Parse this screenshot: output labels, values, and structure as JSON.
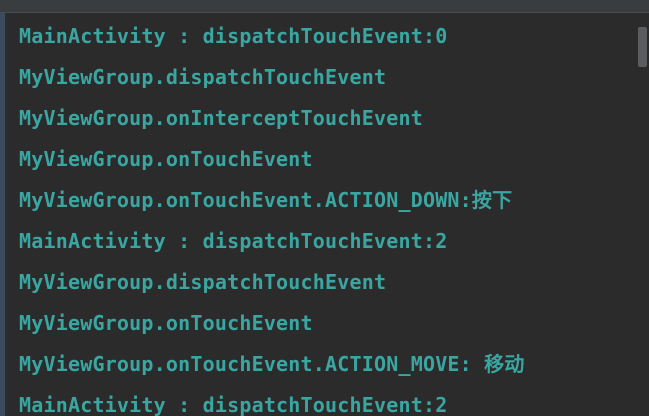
{
  "console": {
    "lines": [
      "MainActivity : dispatchTouchEvent:0",
      "MyViewGroup.dispatchTouchEvent",
      "MyViewGroup.onInterceptTouchEvent",
      "MyViewGroup.onTouchEvent",
      "MyViewGroup.onTouchEvent.ACTION_DOWN:按下",
      "MainActivity : dispatchTouchEvent:2",
      "MyViewGroup.dispatchTouchEvent",
      "MyViewGroup.onTouchEvent",
      "MyViewGroup.onTouchEvent.ACTION_MOVE: 移动",
      "MainActivity : dispatchTouchEvent:2"
    ]
  },
  "colors": {
    "background": "#2b2b2b",
    "log_text": "#3aa6a2",
    "gutter": "#3b4a5e",
    "scrollbar_thumb": "#5a5d60"
  }
}
